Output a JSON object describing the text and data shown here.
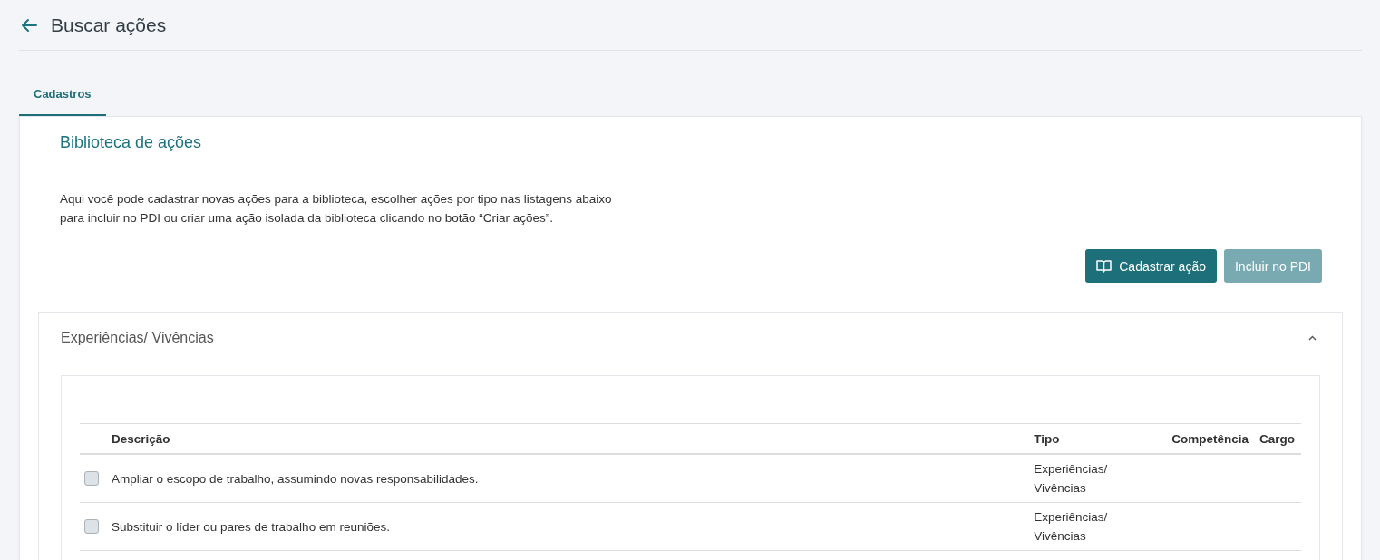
{
  "header": {
    "title": "Buscar ações"
  },
  "tabs": [
    {
      "label": "Cadastros",
      "selected": true
    }
  ],
  "section": {
    "title": "Biblioteca de ações",
    "description": "Aqui você pode cadastrar novas ações para a biblioteca, escolher ações por tipo nas listagens abaixo para incluir no PDI ou criar uma ação isolada da biblioteca clicando no botão “Criar ações”."
  },
  "buttons": [
    {
      "label": "Cadastrar ação",
      "kind": "primary",
      "disabled": false
    },
    {
      "label": "Incluir no PDI",
      "kind": "secondary",
      "disabled": true
    }
  ],
  "accordion": {
    "title": "Experiências/ Vivências",
    "expanded": true
  },
  "table": {
    "columns": [
      "Descrição",
      "Tipo",
      "Competência",
      "Cargo"
    ],
    "rows": [
      {
        "checked": false,
        "description": "Ampliar o escopo de trabalho, assumindo novas responsabilidades.",
        "type": "Experiências/ Vivências"
      },
      {
        "checked": false,
        "description": "Substituir o líder ou pares de trabalho em reuniões.",
        "type": "Experiências/ Vivências"
      }
    ]
  }
}
